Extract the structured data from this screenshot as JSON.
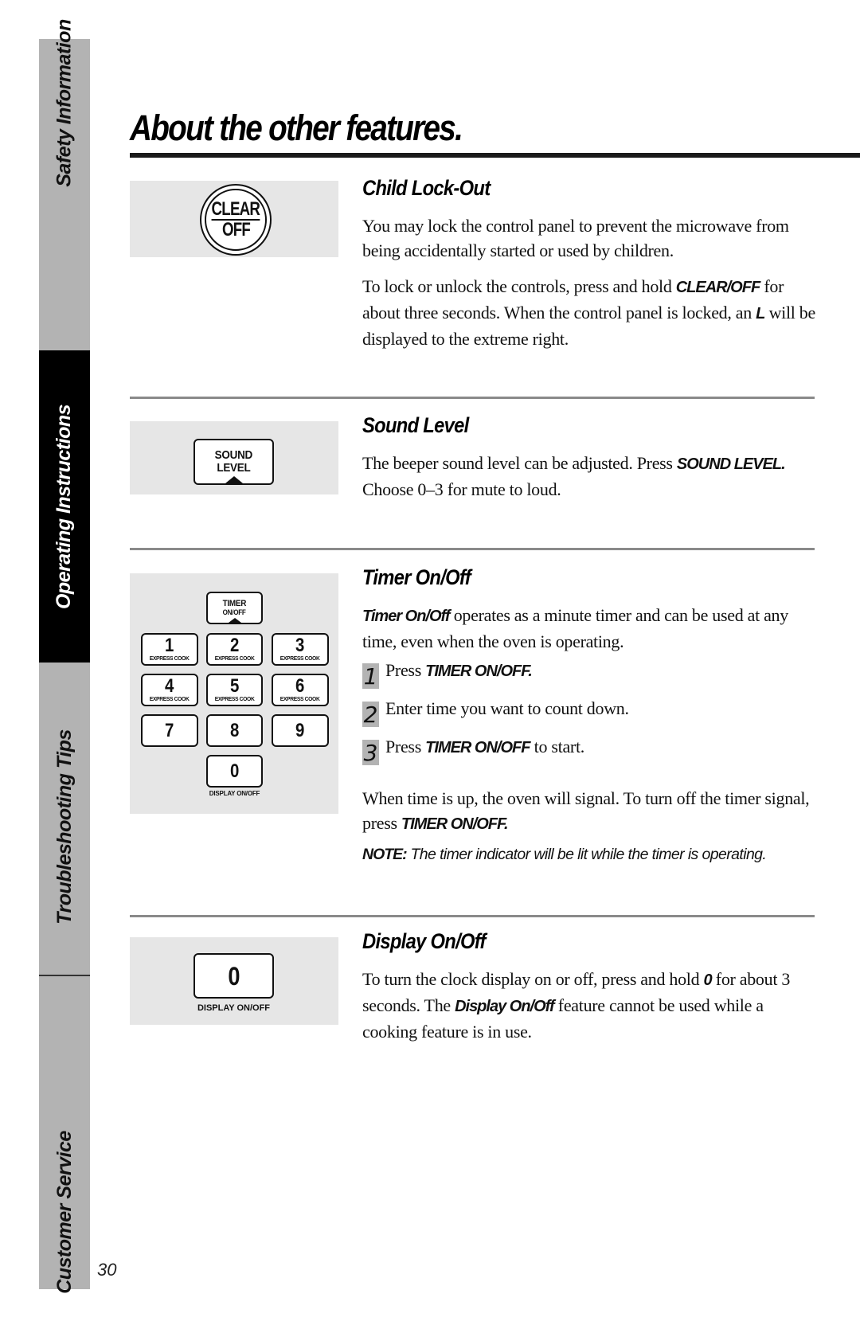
{
  "sidebar": {
    "tabs": [
      {
        "label": "Safety Information",
        "active": false
      },
      {
        "label": "Operating Instructions",
        "active": true
      },
      {
        "label": "Troubleshooting Tips",
        "active": false
      },
      {
        "label": "Customer Service",
        "active": false
      }
    ]
  },
  "page": {
    "title": "About the other features.",
    "number": "30"
  },
  "sections": {
    "child_lockout": {
      "heading": "Child Lock-Out",
      "para1": "You may lock the control panel to prevent the microwave from being accidentally started or used by children.",
      "para2_a": "To lock or unlock the controls, press and hold ",
      "para2_kw1": "CLEAR/OFF",
      "para2_b": " for about three seconds. When the control panel is locked, an ",
      "para2_kw2": "L",
      "para2_c": " will be displayed to the extreme right.",
      "button": {
        "line1": "CLEAR",
        "line2": "OFF"
      }
    },
    "sound_level": {
      "heading": "Sound Level",
      "para_a": "The beeper sound level can be adjusted. Press ",
      "para_kw": "SOUND LEVEL.",
      "para_b": " Choose 0–3 for mute to loud.",
      "button": {
        "line1": "SOUND",
        "line2": "LEVEL"
      }
    },
    "timer": {
      "heading": "Timer On/Off",
      "intro_kw": "Timer On/Off",
      "intro_text": " operates as a minute timer and can be used at any time, even when the oven is operating.",
      "steps": [
        {
          "num": "1",
          "pre": "Press ",
          "kw": "TIMER ON/OFF.",
          "post": ""
        },
        {
          "num": "2",
          "pre": "Enter time you want to count down.",
          "kw": "",
          "post": ""
        },
        {
          "num": "3",
          "pre": "Press ",
          "kw": "TIMER ON/OFF",
          "post": " to start."
        }
      ],
      "signal_a": "When time is up, the oven will signal. To turn off the timer signal, press ",
      "signal_kw": "TIMER ON/OFF.",
      "note_kw": "NOTE:",
      "note_text": " The timer indicator will be lit while the timer is operating.",
      "keypad": {
        "timer_key": {
          "line1": "TIMER",
          "line2": "ON/OFF"
        },
        "keys": [
          {
            "num": "1",
            "sub": "EXPRESS COOK"
          },
          {
            "num": "2",
            "sub": "EXPRESS COOK"
          },
          {
            "num": "3",
            "sub": "EXPRESS COOK"
          },
          {
            "num": "4",
            "sub": "EXPRESS COOK"
          },
          {
            "num": "5",
            "sub": "EXPRESS COOK"
          },
          {
            "num": "6",
            "sub": "EXPRESS COOK"
          },
          {
            "num": "7",
            "sub": ""
          },
          {
            "num": "8",
            "sub": ""
          },
          {
            "num": "9",
            "sub": ""
          }
        ],
        "zero_key": "0",
        "zero_caption": "DISPLAY ON/OFF"
      }
    },
    "display": {
      "heading": "Display On/Off",
      "para_a": "To turn the clock display on or off, press and hold ",
      "para_kw1": "0",
      "para_b": " for about 3 seconds. The ",
      "para_kw2": "Display On/Off",
      "para_c": " feature cannot be used while a cooking feature is in use.",
      "button": {
        "num": "0",
        "caption": "DISPLAY ON/OFF"
      }
    }
  }
}
